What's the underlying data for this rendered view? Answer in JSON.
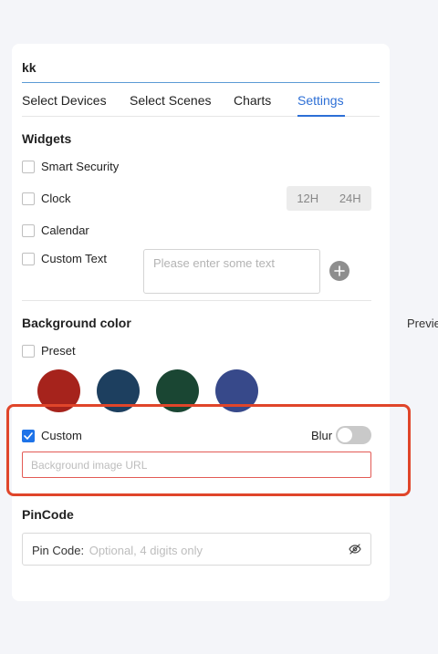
{
  "header": {
    "title": "kk"
  },
  "tabs": [
    {
      "label": "Select Devices",
      "active": false
    },
    {
      "label": "Select Scenes",
      "active": false
    },
    {
      "label": "Charts",
      "active": false
    },
    {
      "label": "Settings",
      "active": true
    }
  ],
  "widgets": {
    "title": "Widgets",
    "smart_security": "Smart Security",
    "clock": "Clock",
    "clock_formats": [
      "12H",
      "24H"
    ],
    "calendar": "Calendar",
    "custom_text": "Custom Text",
    "custom_text_placeholder": "Please enter some text"
  },
  "background": {
    "title": "Background color",
    "preset_label": "Preset",
    "preset_colors": [
      "#a6231c",
      "#1d3f5f",
      "#1a4633",
      "#37498a"
    ],
    "custom_label": "Custom",
    "custom_checked": true,
    "blur_label": "Blur",
    "blur_enabled": false,
    "url_placeholder": "Background image URL"
  },
  "preview_label": "Previe",
  "pincode": {
    "title": "PinCode",
    "label": "Pin Code:",
    "placeholder": "Optional, 4 digits only"
  },
  "colors": {
    "accent": "#2d6fd6",
    "highlight": "#e0452a",
    "error_border": "#e35a55"
  }
}
